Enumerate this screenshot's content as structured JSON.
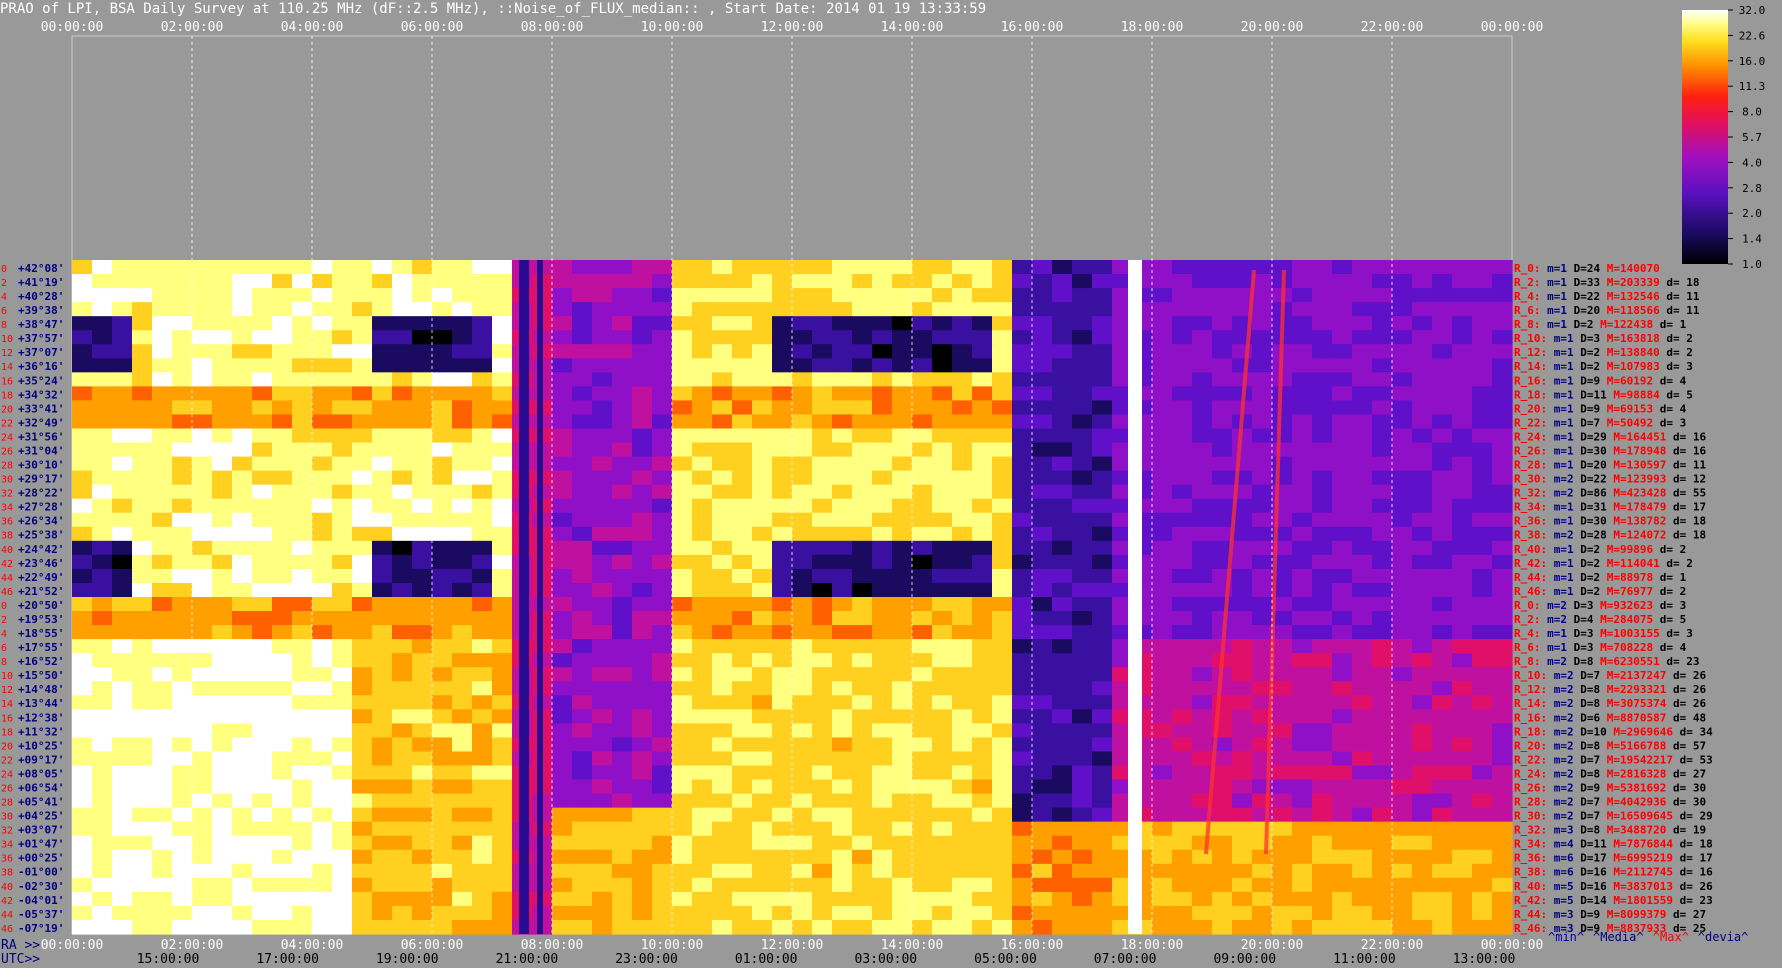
{
  "header": {
    "title": "PRAO of LPI, BSA Daily Survey at 110.25 MHz (dF::2.5 MHz), ::Noise_of_FLUX_median:: , Start Date: 2014 01 19 13:33:59"
  },
  "colors": {
    "background": "#999999",
    "grid": "#ffffff",
    "dec_label": "#000080",
    "row_index": "#ff0000",
    "ra_label": "#0000aa",
    "hi": "#ffffff",
    "lo": "#000000"
  },
  "chart_data": {
    "type": "heatmap",
    "title": "PRAO of LPI, BSA Daily Survey at 110.25 MHz (dF::2.5 MHz), ::Noise_of_FLUX_median:: , Start Date: 2014 01 19 13:33:59",
    "top_axis_ticks": [
      "00:00:00",
      "02:00:00",
      "04:00:00",
      "06:00:00",
      "08:00:00",
      "10:00:00",
      "12:00:00",
      "14:00:00",
      "16:00:00",
      "18:00:00",
      "20:00:00",
      "22:00:00",
      "00:00:00"
    ],
    "ra_axis_label": "RA >>",
    "ra_axis_ticks": [
      "00:00:00",
      "02:00:00",
      "04:00:00",
      "06:00:00",
      "08:00:00",
      "10:00:00",
      "12:00:00",
      "14:00:00",
      "16:00:00",
      "18:00:00",
      "20:00:00",
      "22:00:00",
      "00:00:00"
    ],
    "utc_axis_label": "UTC>>",
    "utc_axis_ticks": [
      "15:00:00",
      "17:00:00",
      "19:00:00",
      "21:00:00",
      "23:00:00",
      "01:00:00",
      "03:00:00",
      "05:00:00",
      "07:00:00",
      "09:00:00",
      "11:00:00",
      "13:00:00"
    ],
    "colorbar": {
      "ticks": [
        "32.0",
        "22.6",
        "16.0",
        "11.3",
        "8.0",
        "5.7",
        "4.0",
        "2.8",
        "2.0",
        "1.4",
        "1.0"
      ],
      "scale": "log"
    },
    "bottom_legend": [
      {
        "text": "^min^",
        "color": "#0000aa"
      },
      {
        "text": "^Media^",
        "color": "#000080"
      },
      {
        "text": "^Max^",
        "color": "#ff0000"
      },
      {
        "text": "^devia^",
        "color": "#000080"
      }
    ],
    "dec_labels": [
      "+42°08'",
      "+41°19'",
      "+40°28'",
      "+39°38'",
      "+38°47'",
      "+37°57'",
      "+37°07'",
      "+36°16'",
      "+35°24'",
      "+34°32'",
      "+33°41'",
      "+32°49'",
      "+31°56'",
      "+31°04'",
      "+30°10'",
      "+29°17'",
      "+28°22'",
      "+27°28'",
      "+26°34'",
      "+25°38'",
      "+24°42'",
      "+23°46'",
      "+22°49'",
      "+21°52'",
      "+20°50'",
      "+19°53'",
      "+18°55'",
      "+17°55'",
      "+16°52'",
      "+15°50'",
      "+14°48'",
      "+13°44'",
      "+12°38'",
      "+11°32'",
      "+10°25'",
      "+09°17'",
      "+08°05'",
      "+06°54'",
      "+05°41'",
      "+04°25'",
      "+03°07'",
      "+01°47'",
      "+00°25'",
      "-01°00'",
      "-02°30'",
      "-04°01'",
      "-05°37'",
      "-07°19'"
    ],
    "left_row_numbers": [
      "0",
      "2",
      "4",
      "6",
      "8",
      "10",
      "12",
      "14",
      "16",
      "18",
      "20",
      "22",
      "24",
      "26",
      "28",
      "30",
      "32",
      "34",
      "36",
      "38",
      "40",
      "42",
      "44",
      "46",
      "0",
      "2",
      "4",
      "6",
      "8",
      "10",
      "12",
      "14",
      "16",
      "18",
      "20",
      "22",
      "24",
      "26",
      "28",
      "30",
      "32",
      "34",
      "36",
      "38",
      "40",
      "42",
      "44",
      "46"
    ],
    "row_stats": [
      {
        "r": "R_0:",
        "m": "m=1",
        "D": "D=24",
        "M": "M=140070",
        "d": ""
      },
      {
        "r": "R_2:",
        "m": "m=1",
        "D": "D=33",
        "M": "M=203339",
        "d": "d= 18"
      },
      {
        "r": "R_4:",
        "m": "m=1",
        "D": "D=22",
        "M": "M=132546",
        "d": "d= 11"
      },
      {
        "r": "R_6:",
        "m": "m=1",
        "D": "D=20",
        "M": "M=118566",
        "d": "d= 11"
      },
      {
        "r": "R_8:",
        "m": "m=1",
        "D": "D=2",
        "M": "M=122438",
        "d": "d= 1"
      },
      {
        "r": "R_10:",
        "m": "m=1",
        "D": "D=3",
        "M": "M=163818",
        "d": "d= 2"
      },
      {
        "r": "R_12:",
        "m": "m=1",
        "D": "D=2",
        "M": "M=138840",
        "d": "d= 2"
      },
      {
        "r": "R_14:",
        "m": "m=1",
        "D": "D=2",
        "M": "M=107983",
        "d": "d= 3"
      },
      {
        "r": "R_16:",
        "m": "m=1",
        "D": "D=9",
        "M": "M=60192",
        "d": "d= 4"
      },
      {
        "r": "R_18:",
        "m": "m=1",
        "D": "D=11",
        "M": "M=98884",
        "d": "d= 5"
      },
      {
        "r": "R_20:",
        "m": "m=1",
        "D": "D=9",
        "M": "M=69153",
        "d": "d= 4"
      },
      {
        "r": "R_22:",
        "m": "m=1",
        "D": "D=7",
        "M": "M=50492",
        "d": "d= 3"
      },
      {
        "r": "R_24:",
        "m": "m=1",
        "D": "D=29",
        "M": "M=164451",
        "d": "d= 16"
      },
      {
        "r": "R_26:",
        "m": "m=1",
        "D": "D=30",
        "M": "M=178948",
        "d": "d= 16"
      },
      {
        "r": "R_28:",
        "m": "m=1",
        "D": "D=20",
        "M": "M=130597",
        "d": "d= 11"
      },
      {
        "r": "R_30:",
        "m": "m=2",
        "D": "D=22",
        "M": "M=123993",
        "d": "d= 12"
      },
      {
        "r": "R_32:",
        "m": "m=2",
        "D": "D=86",
        "M": "M=423428",
        "d": "d= 55"
      },
      {
        "r": "R_34:",
        "m": "m=1",
        "D": "D=31",
        "M": "M=178479",
        "d": "d= 17"
      },
      {
        "r": "R_36:",
        "m": "m=1",
        "D": "D=30",
        "M": "M=138782",
        "d": "d= 18"
      },
      {
        "r": "R_38:",
        "m": "m=2",
        "D": "D=28",
        "M": "M=124072",
        "d": "d= 18"
      },
      {
        "r": "R_40:",
        "m": "m=1",
        "D": "D=2",
        "M": "M=99896",
        "d": "d= 2"
      },
      {
        "r": "R_42:",
        "m": "m=1",
        "D": "D=2",
        "M": "M=114041",
        "d": "d= 2"
      },
      {
        "r": "R_44:",
        "m": "m=1",
        "D": "D=2",
        "M": "M=88978",
        "d": "d= 1"
      },
      {
        "r": "R_46:",
        "m": "m=1",
        "D": "D=2",
        "M": "M=76977",
        "d": "d= 2"
      },
      {
        "r": "R_0:",
        "m": "m=2",
        "D": "D=3",
        "M": "M=932623",
        "d": "d= 3"
      },
      {
        "r": "R_2:",
        "m": "m=2",
        "D": "D=4",
        "M": "M=284075",
        "d": "d= 5"
      },
      {
        "r": "R_4:",
        "m": "m=1",
        "D": "D=3",
        "M": "M=1003155",
        "d": "d= 3"
      },
      {
        "r": "R_6:",
        "m": "m=1",
        "D": "D=3",
        "M": "M=708228",
        "d": "d= 4"
      },
      {
        "r": "R_8:",
        "m": "m=2",
        "D": "D=8",
        "M": "M=6230551",
        "d": "d= 23"
      },
      {
        "r": "R_10:",
        "m": "m=2",
        "D": "D=7",
        "M": "M=2137247",
        "d": "d= 26"
      },
      {
        "r": "R_12:",
        "m": "m=2",
        "D": "D=8",
        "M": "M=2293321",
        "d": "d= 26"
      },
      {
        "r": "R_14:",
        "m": "m=2",
        "D": "D=8",
        "M": "M=3075374",
        "d": "d= 26"
      },
      {
        "r": "R_16:",
        "m": "m=2",
        "D": "D=6",
        "M": "M=8870587",
        "d": "d= 48"
      },
      {
        "r": "R_18:",
        "m": "m=2",
        "D": "D=10",
        "M": "M=2969646",
        "d": "d= 34"
      },
      {
        "r": "R_20:",
        "m": "m=2",
        "D": "D=8",
        "M": "M=5166788",
        "d": "d= 57"
      },
      {
        "r": "R_22:",
        "m": "m=2",
        "D": "D=7",
        "M": "M=19542217",
        "d": "d= 53"
      },
      {
        "r": "R_24:",
        "m": "m=2",
        "D": "D=8",
        "M": "M=2816328",
        "d": "d= 27"
      },
      {
        "r": "R_26:",
        "m": "m=2",
        "D": "D=9",
        "M": "M=5381692",
        "d": "d= 30"
      },
      {
        "r": "R_28:",
        "m": "m=2",
        "D": "D=7",
        "M": "M=4042936",
        "d": "d= 30"
      },
      {
        "r": "R_30:",
        "m": "m=2",
        "D": "D=7",
        "M": "M=16509645",
        "d": "d= 29"
      },
      {
        "r": "R_32:",
        "m": "m=3",
        "D": "D=8",
        "M": "M=3488720",
        "d": "d= 19"
      },
      {
        "r": "R_34:",
        "m": "m=4",
        "D": "D=11",
        "M": "M=7876844",
        "d": "d= 18"
      },
      {
        "r": "R_36:",
        "m": "m=6",
        "D": "D=17",
        "M": "M=6995219",
        "d": "d= 17"
      },
      {
        "r": "R_38:",
        "m": "m=6",
        "D": "D=16",
        "M": "M=2112745",
        "d": "d= 16"
      },
      {
        "r": "R_40:",
        "m": "m=5",
        "D": "D=16",
        "M": "M=3837013",
        "d": "d= 26"
      },
      {
        "r": "R_42:",
        "m": "m=5",
        "D": "D=14",
        "M": "M=1801559",
        "d": "d= 23"
      },
      {
        "r": "R_44:",
        "m": "m=3",
        "D": "D=9",
        "M": "M=8099379",
        "d": "d= 27"
      },
      {
        "r": "R_46:",
        "m": "m=3",
        "D": "D=9",
        "M": "M=8837933",
        "d": "d= 25"
      }
    ]
  }
}
